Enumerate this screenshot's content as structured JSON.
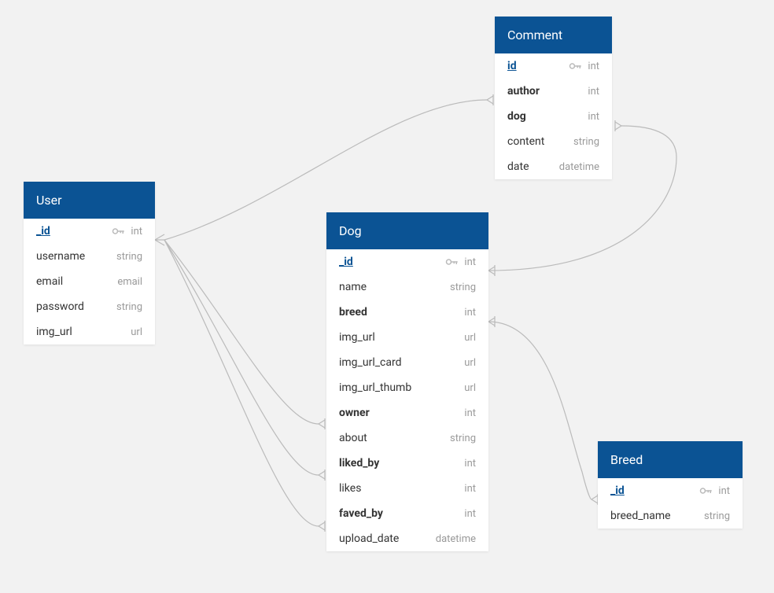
{
  "entities": {
    "user": {
      "title": "User",
      "fields": [
        {
          "name": "_id",
          "type": "int",
          "pk": true,
          "fk": false
        },
        {
          "name": "username",
          "type": "string",
          "pk": false,
          "fk": false
        },
        {
          "name": "email",
          "type": "email",
          "pk": false,
          "fk": false
        },
        {
          "name": "password",
          "type": "string",
          "pk": false,
          "fk": false
        },
        {
          "name": "img_url",
          "type": "url",
          "pk": false,
          "fk": false
        }
      ]
    },
    "comment": {
      "title": "Comment",
      "fields": [
        {
          "name": "id",
          "type": "int",
          "pk": true,
          "fk": false
        },
        {
          "name": "author",
          "type": "int",
          "pk": false,
          "fk": true
        },
        {
          "name": "dog",
          "type": "int",
          "pk": false,
          "fk": true
        },
        {
          "name": "content",
          "type": "string",
          "pk": false,
          "fk": false
        },
        {
          "name": "date",
          "type": "datetime",
          "pk": false,
          "fk": false
        }
      ]
    },
    "dog": {
      "title": "Dog",
      "fields": [
        {
          "name": "_id",
          "type": "int",
          "pk": true,
          "fk": false
        },
        {
          "name": "name",
          "type": "string",
          "pk": false,
          "fk": false
        },
        {
          "name": "breed",
          "type": "int",
          "pk": false,
          "fk": true
        },
        {
          "name": "img_url",
          "type": "url",
          "pk": false,
          "fk": false
        },
        {
          "name": "img_url_card",
          "type": "url",
          "pk": false,
          "fk": false
        },
        {
          "name": "img_url_thumb",
          "type": "url",
          "pk": false,
          "fk": false
        },
        {
          "name": "owner",
          "type": "int",
          "pk": false,
          "fk": true
        },
        {
          "name": "about",
          "type": "string",
          "pk": false,
          "fk": false
        },
        {
          "name": "liked_by",
          "type": "int",
          "pk": false,
          "fk": true
        },
        {
          "name": "likes",
          "type": "int",
          "pk": false,
          "fk": false
        },
        {
          "name": "faved_by",
          "type": "int",
          "pk": false,
          "fk": true
        },
        {
          "name": "upload_date",
          "type": "datetime",
          "pk": false,
          "fk": false
        }
      ]
    },
    "breed": {
      "title": "Breed",
      "fields": [
        {
          "name": "_id",
          "type": "int",
          "pk": true,
          "fk": false
        },
        {
          "name": "breed_name",
          "type": "string",
          "pk": false,
          "fk": false
        }
      ]
    }
  },
  "relationships": [
    {
      "from": "user._id",
      "to": "comment.author"
    },
    {
      "from": "user._id",
      "to": "dog.owner"
    },
    {
      "from": "user._id",
      "to": "dog.liked_by"
    },
    {
      "from": "user._id",
      "to": "dog.faved_by"
    },
    {
      "from": "dog._id",
      "to": "comment.dog"
    },
    {
      "from": "dog.breed",
      "to": "breed._id"
    }
  ]
}
